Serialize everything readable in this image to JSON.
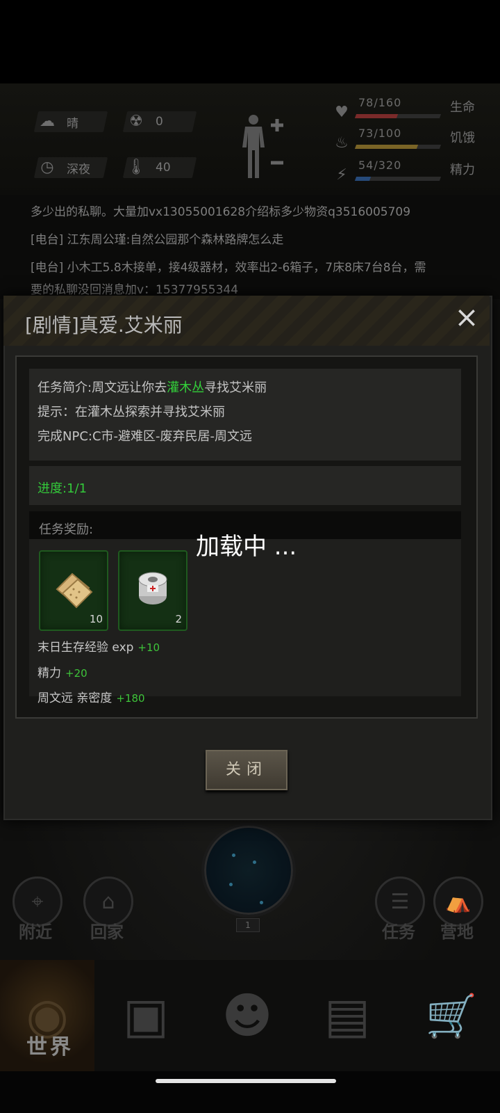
{
  "hud": {
    "weather": "晴",
    "radiation": "0",
    "time_of_day": "深夜",
    "temperature": "40",
    "stats": [
      {
        "value": "78/160",
        "label": "生命",
        "fraction": 0.49,
        "color": "#7a2a2a",
        "icon": "heart-icon"
      },
      {
        "value": "73/100",
        "label": "饥饿",
        "fraction": 0.73,
        "color": "#7a6426",
        "icon": "stomach-icon"
      },
      {
        "value": "54/320",
        "label": "精力",
        "fraction": 0.17,
        "color": "#264a7a",
        "icon": "brain-icon"
      }
    ]
  },
  "chat": {
    "lines": [
      "多少出的私聊。大量加vx13055001628介绍标多少物资q3516005709",
      "[电台] 江东周公瑾:自然公园那个森林路牌怎么走",
      "[电台] 小木工5.8木接单，接4级器材，效率出2-6箱子，7床8床7台8台，需",
      "要的私聊没回消息加v：15377955344"
    ]
  },
  "modal": {
    "title": "[剧情]真爱.艾米丽",
    "close_icon": "×",
    "desc_prefix": "任务简介:周文远让你去",
    "desc_highlight": "灌木丛",
    "desc_suffix": "寻找艾米丽",
    "hint": "提示：在灌木丛探索并寻找艾米丽",
    "npc": "完成NPC:C市-避难区-废弃民居-周文远",
    "progress": "进度:1/1",
    "reward_title": "任务奖励:",
    "items": [
      {
        "name": "crackers",
        "qty": "10"
      },
      {
        "name": "bandage",
        "qty": "2"
      }
    ],
    "rewards": [
      {
        "label": "末日生存经验 exp",
        "amount": "+10"
      },
      {
        "label": "精力",
        "amount": "+20"
      },
      {
        "label": "周文远 亲密度",
        "amount": "+180"
      }
    ],
    "close_button": "关闭"
  },
  "loading_text": "加载中 ...",
  "actions": {
    "nearby": "附近",
    "home": "回家",
    "tasks": "任务",
    "camp": "营地",
    "radar_level": "1"
  },
  "nav": {
    "world": "世界"
  }
}
